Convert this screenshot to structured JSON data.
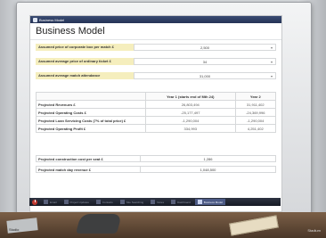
{
  "window": {
    "app_title": "Business Model",
    "page_title": "Business Model"
  },
  "form": {
    "rows": [
      {
        "label": "Assumed price of corporate box per match £",
        "value": "2,500"
      },
      {
        "label": "Assumed average price of ordinary ticket £",
        "value": "34"
      },
      {
        "label": "Assumed average match attendance",
        "value": "31,000"
      }
    ]
  },
  "projections": {
    "headers": [
      "",
      "Year 1 (starts end of Mth 24)",
      "Year 2"
    ],
    "rows": [
      {
        "label": "Projected Revenues £",
        "y1": "26,803,494",
        "y2": "31,911,402"
      },
      {
        "label": "Projected Operating Costs £",
        "y1": "-25,177,497",
        "y2": "-24,369,996"
      },
      {
        "label": "Projected Loan Servicing Costs (7% of total price) £",
        "y1": "-1,290,004",
        "y2": "-1,290,004"
      },
      {
        "label": "Projected Operating Profit £",
        "y1": "334,993",
        "y2": "4,251,402"
      }
    ]
  },
  "info": [
    {
      "label": "Projected construction cost per seat £",
      "value": "1,286"
    },
    {
      "label": "Projected match day revenue £",
      "value": "1,048,500"
    }
  ],
  "taskbar": {
    "items": [
      {
        "label": "Email",
        "active": false
      },
      {
        "label": "Project Updates",
        "active": false
      },
      {
        "label": "Contacts",
        "active": false
      },
      {
        "label": "Site Searching",
        "active": false
      },
      {
        "label": "Notes",
        "active": false
      },
      {
        "label": "Dashboard",
        "active": false
      },
      {
        "label": "Business Model",
        "active": true
      }
    ]
  },
  "desk": {
    "left_label": "Studio",
    "right_label": "Stadium"
  }
}
